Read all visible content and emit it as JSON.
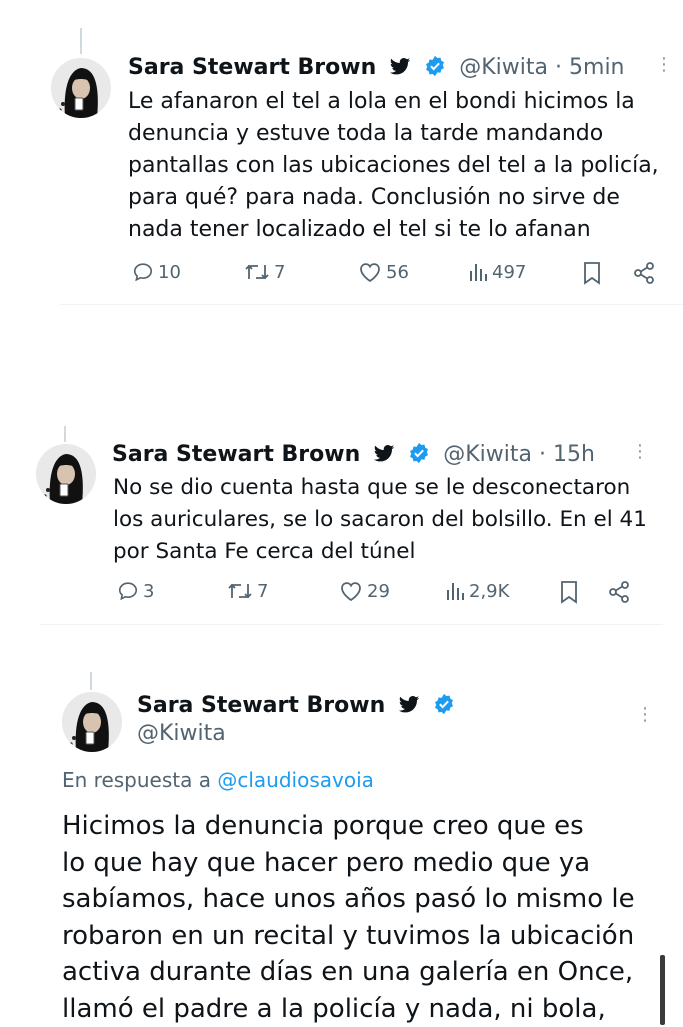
{
  "tweets": [
    {
      "name": "Sara Stewart Brown",
      "handle": "@Kiwita",
      "separator": "·",
      "time": "5min",
      "text_lines": [
        "Le afanaron el tel a lola en el bondi hicimos la",
        "denuncia y estuve toda la tarde mandando",
        "pantallas con las ubicaciones del tel a la policía,",
        "para qué? para nada. Conclusión no sirve de",
        "nada tener localizado el tel si te lo afanan"
      ],
      "replies": "10",
      "retweets": "7",
      "likes": "56",
      "views": "497"
    },
    {
      "name": "Sara Stewart Brown",
      "handle": "@Kiwita",
      "separator": "·",
      "time": "15h",
      "text_lines": [
        "No se dio cuenta hasta que se le desconectaron",
        "los auriculares, se lo sacaron del bolsillo. En el 41",
        "por Santa Fe cerca del túnel"
      ],
      "replies": "3",
      "retweets": "7",
      "likes": "29",
      "views": "2,9K"
    }
  ],
  "detail": {
    "name": "Sara Stewart Brown",
    "handle": "@Kiwita",
    "reply_prefix": "En respuesta a",
    "reply_mention": "@claudiosavoia",
    "text_lines": [
      "Hicimos la denuncia porque creo que es",
      "lo que hay que hacer pero medio que ya",
      "sabíamos, hace unos años pasó lo mismo le",
      "robaron en un recital y tuvimos la ubicación",
      "activa durante días en una galería en Once,",
      "llamó el padre a la policía y nada, ni bola,"
    ]
  },
  "icons": {
    "hand_emoji": "🖤",
    "verified": "verified-badge-icon",
    "bird": "twitter-bird-icon"
  },
  "colors": {
    "verified_blue": "#1d9bf0",
    "secondary_text": "#536471",
    "divider": "#eff3f4"
  }
}
